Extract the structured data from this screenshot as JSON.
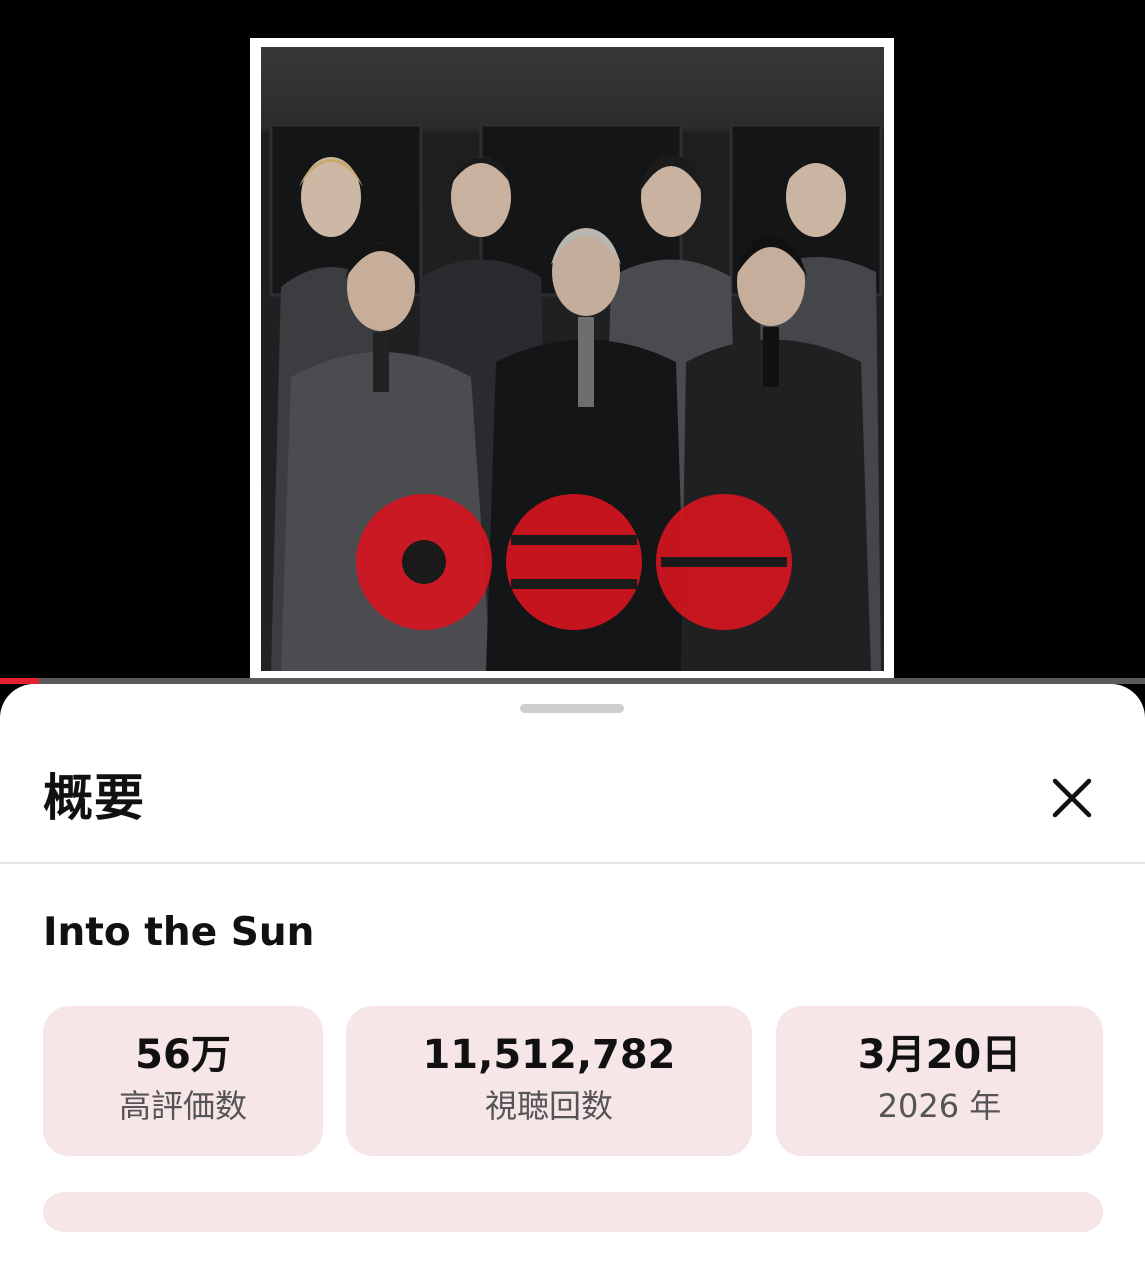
{
  "player": {
    "progress_fraction": 0.034,
    "accent_color": "#e5212f"
  },
  "sheet": {
    "title": "概要",
    "close_icon": "close-icon"
  },
  "video": {
    "title": "Into the Sun"
  },
  "stats": [
    {
      "value": "56万",
      "label": "高評価数"
    },
    {
      "value": "11,512,782",
      "label": "視聴回数"
    },
    {
      "value": "3月20日",
      "label": "2026 年"
    }
  ],
  "colors": {
    "card_bg": "#f7e6e8",
    "logo_red": "#d8141f"
  }
}
